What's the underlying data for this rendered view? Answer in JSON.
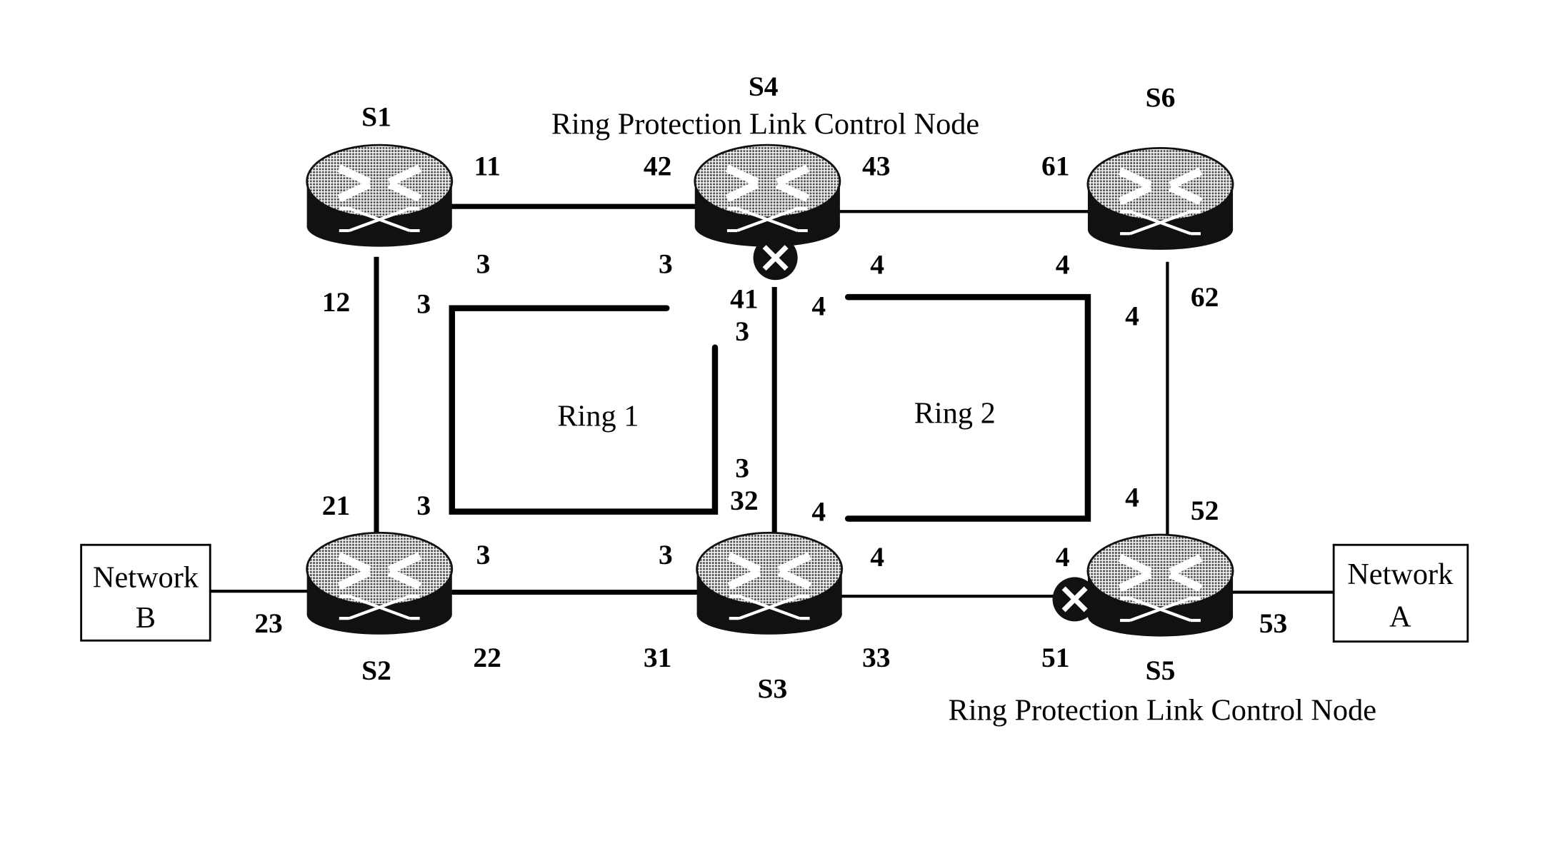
{
  "nodes": {
    "S1": {
      "name": "S1"
    },
    "S2": {
      "name": "S2"
    },
    "S3": {
      "name": "S3"
    },
    "S4": {
      "name": "S4",
      "role": "Ring Protection Link Control Node"
    },
    "S5": {
      "name": "S5",
      "role": "Ring Protection Link Control Node"
    },
    "S6": {
      "name": "S6"
    }
  },
  "networks": {
    "A": {
      "line1": "Network",
      "line2": "A"
    },
    "B": {
      "line1": "Network",
      "line2": "B"
    }
  },
  "rings": {
    "ring1": "Ring 1",
    "ring2": "Ring 2"
  },
  "ports": {
    "p11": "11",
    "p12": "12",
    "p21": "21",
    "p22": "22",
    "p23": "23",
    "p31": "31",
    "p32": "32",
    "p33": "33",
    "p41": "41",
    "p42": "42",
    "p43": "43",
    "p51": "51",
    "p52": "52",
    "p53": "53",
    "p61": "61",
    "p62": "62"
  },
  "ring_marks": {
    "ring1": "3",
    "ring2": "4"
  },
  "blocked_ports": [
    "41",
    "51"
  ]
}
